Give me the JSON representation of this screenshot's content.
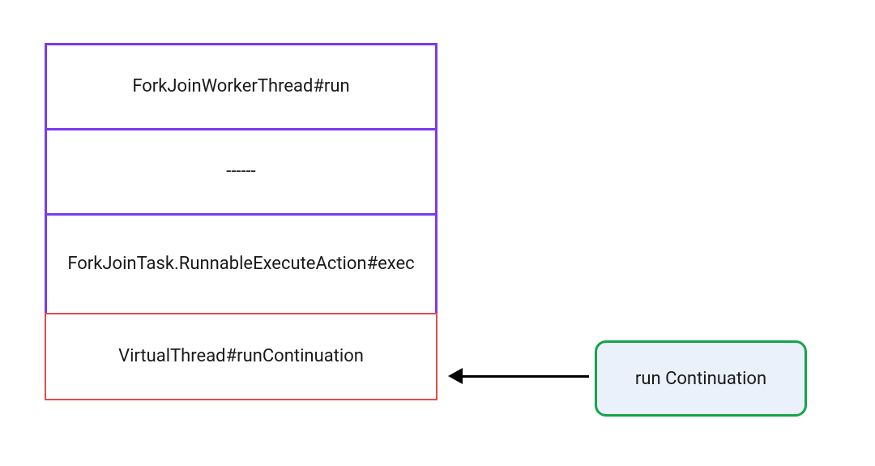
{
  "stack": {
    "frames": [
      {
        "label": "ForkJoinWorkerThread#run"
      },
      {
        "label": "------"
      },
      {
        "label": "ForkJoinTask.RunnableExecuteAction#exec"
      },
      {
        "label": "VirtualThread#runContinuation"
      }
    ]
  },
  "side_box": {
    "label": "run Continuation"
  },
  "colors": {
    "stack_border": "#7c3aed",
    "bottom_border": "#e24b4b",
    "side_border": "#16a34a",
    "side_fill": "#eaf1fb"
  }
}
